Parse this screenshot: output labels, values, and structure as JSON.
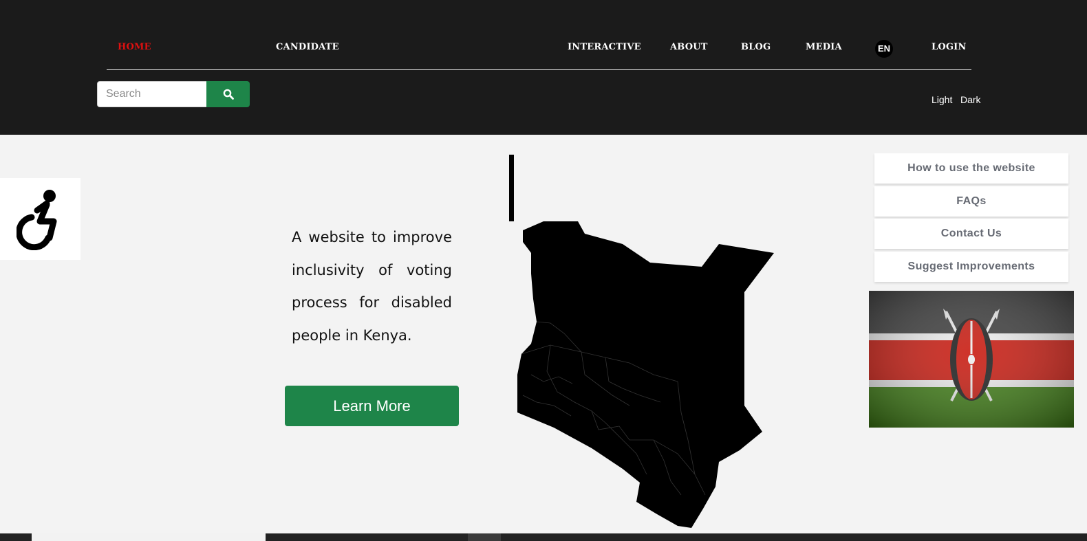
{
  "nav": {
    "home": "HOME",
    "candidate": "CANDIDATE",
    "interactive": "INTERACTIVE",
    "about": "ABOUT",
    "blog": "BLOG",
    "media": "MEDIA",
    "language": "EN",
    "login": "LOGIN"
  },
  "search": {
    "placeholder": "Search",
    "icon": "search-icon"
  },
  "theme": {
    "light": "Light",
    "dark": "Dark"
  },
  "accessibility": {
    "icon": "wheelchair-icon"
  },
  "hero": {
    "text": "A website to improve inclusivity of voting process for disabled people in Kenya.",
    "button": "Learn More"
  },
  "side_menu": [
    {
      "label": "How to use the website"
    },
    {
      "label": "FAQs"
    },
    {
      "label": "Contact Us"
    },
    {
      "label": "Suggest Improvements"
    }
  ],
  "colors": {
    "header_bg": "#1b1b1b",
    "active_nav": "#e01010",
    "accent_green": "#1e8549",
    "page_bg": "#f3f3f3"
  }
}
